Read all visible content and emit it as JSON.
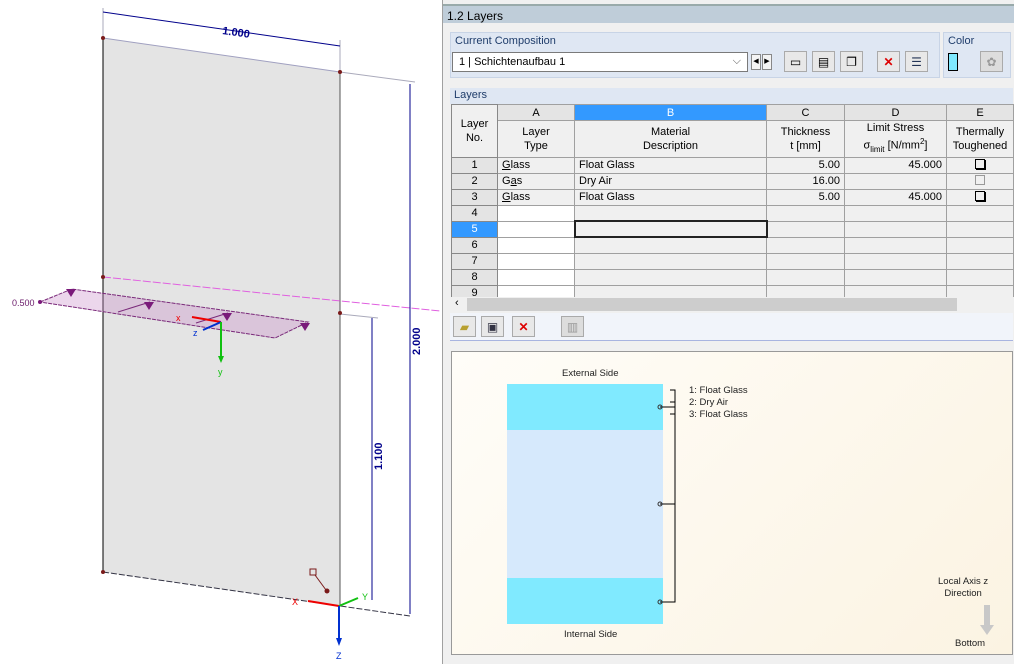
{
  "model_view": {
    "dim_width": "1.000",
    "dim_height": "2.000",
    "dim_partial": "1.100",
    "line_pos": "0.500",
    "axes": {
      "x": "x",
      "y": "y",
      "z": "z",
      "X": "X",
      "Y": "Y",
      "Z": "Z"
    }
  },
  "panel": {
    "title": "1.2 Layers"
  },
  "composition": {
    "label": "Current Composition",
    "value": "1 | Schichtenaufbau 1",
    "buttons": [
      "new-composition-icon",
      "edit-composition-icon",
      "copy-composition-icon",
      "delete-icon",
      "import-icon"
    ]
  },
  "color": {
    "label": "Color",
    "swatch": "#7fe9ff"
  },
  "layers": {
    "label": "Layers",
    "col_letters": [
      "A",
      "B",
      "C",
      "D",
      "E"
    ],
    "headers": {
      "no": [
        "Layer",
        "No."
      ],
      "a": [
        "Layer",
        "Type"
      ],
      "b": [
        "Material",
        "Description"
      ],
      "c": [
        "Thickness",
        "t [mm]"
      ],
      "d1": "Limit Stress",
      "d_sym": "σ",
      "d_sub": "limit",
      "d_unit": " [N/mm",
      "d_sup": "2",
      "d_close": "]",
      "e": [
        "Thermally",
        "Toughened"
      ]
    },
    "rows": [
      {
        "no": "1",
        "type": "Glass",
        "material": "Float Glass",
        "thickness": "5.00",
        "stress": "45.000",
        "toughened": false,
        "enabled": true
      },
      {
        "no": "2",
        "type": "Gas",
        "material": "Dry Air",
        "thickness": "16.00",
        "stress": "",
        "toughened": false,
        "enabled": false
      },
      {
        "no": "3",
        "type": "Glass",
        "material": "Float Glass",
        "thickness": "5.00",
        "stress": "45.000",
        "toughened": false,
        "enabled": true
      },
      {
        "no": "4"
      },
      {
        "no": "5"
      },
      {
        "no": "6"
      },
      {
        "no": "7"
      },
      {
        "no": "8"
      },
      {
        "no": "9"
      }
    ],
    "selected_row": "5",
    "selected_col": "B"
  },
  "preview": {
    "external": "External Side",
    "internal": "Internal Side",
    "legend": [
      "1: Float Glass",
      "2: Dry Air",
      "3: Float Glass"
    ],
    "axis_label": [
      "Local Axis z",
      "Direction"
    ],
    "bottom": "Bottom",
    "glass_color": "#80eaff",
    "gas_color": "#d6e9fc"
  }
}
